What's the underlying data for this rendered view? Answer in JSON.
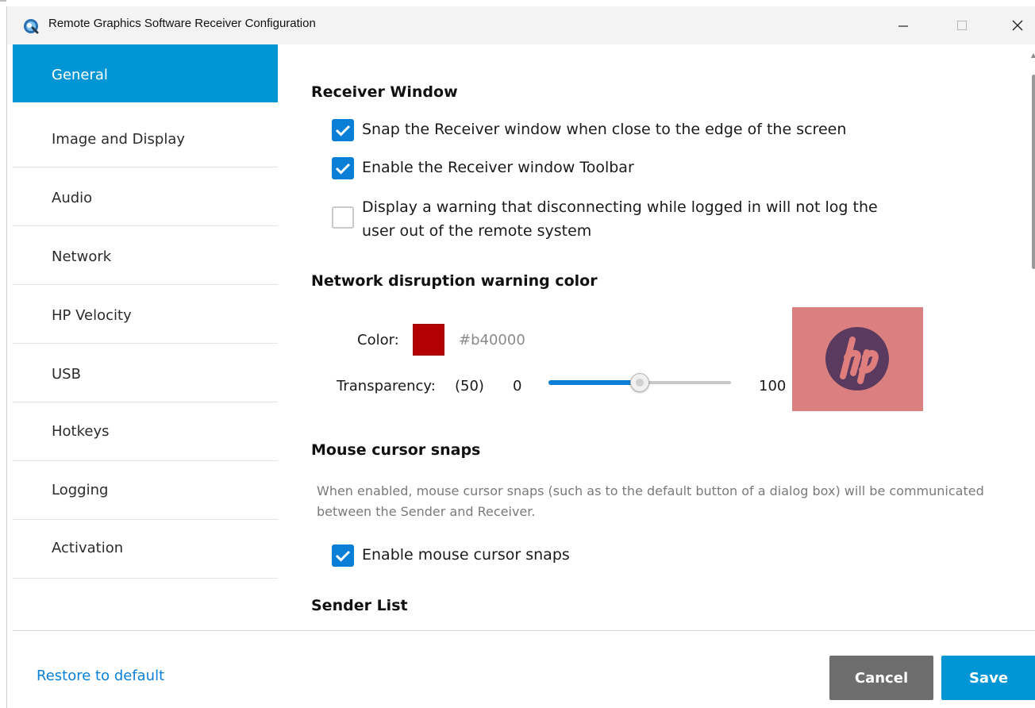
{
  "window": {
    "title": "Remote Graphics Software Receiver Configuration",
    "controls": {
      "minimize": "—",
      "maximize": "☐",
      "close": "✕"
    }
  },
  "sidebar": {
    "items": [
      {
        "label": "General",
        "active": true
      },
      {
        "label": "Image and Display",
        "active": false
      },
      {
        "label": "Audio",
        "active": false
      },
      {
        "label": "Network",
        "active": false
      },
      {
        "label": "HP Velocity",
        "active": false
      },
      {
        "label": "USB",
        "active": false
      },
      {
        "label": "Hotkeys",
        "active": false
      },
      {
        "label": "Logging",
        "active": false
      },
      {
        "label": "Activation",
        "active": false
      }
    ]
  },
  "receiver_window": {
    "heading": "Receiver Window",
    "options": [
      {
        "label": "Snap the Receiver window when close to the edge of the screen",
        "checked": true
      },
      {
        "label": "Enable the Receiver window Toolbar",
        "checked": true
      },
      {
        "label": "Display a warning that disconnecting while logged in will not log the user out of the remote system",
        "checked": false
      }
    ]
  },
  "network_warning": {
    "heading": "Network disruption warning color",
    "color_label": "Color:",
    "color_hex": "#b40000",
    "transparency_label": "Transparency:",
    "transparency_value": "(50)",
    "slider_min": "0",
    "slider_max": "100",
    "transparency_fraction": 0.5,
    "preview_logo": "hp-logo"
  },
  "mouse_snaps": {
    "heading": "Mouse cursor snaps",
    "description": "When enabled, mouse cursor snaps (such as to the default button of a dialog box) will be communicated between the Sender and Receiver.",
    "option": {
      "label": "Enable mouse cursor snaps",
      "checked": true
    }
  },
  "sender_list": {
    "heading": "Sender List"
  },
  "footer": {
    "restore_label": "Restore to default",
    "cancel_label": "Cancel",
    "save_label": "Save"
  },
  "colors": {
    "accent": "#0096d6",
    "checkbox": "#0a7fd8",
    "cancel": "#6e6e6e",
    "warning_color": "#b40000"
  },
  "icons": {
    "app": "remote-graphics-app-icon",
    "check": "checkmark-icon"
  }
}
